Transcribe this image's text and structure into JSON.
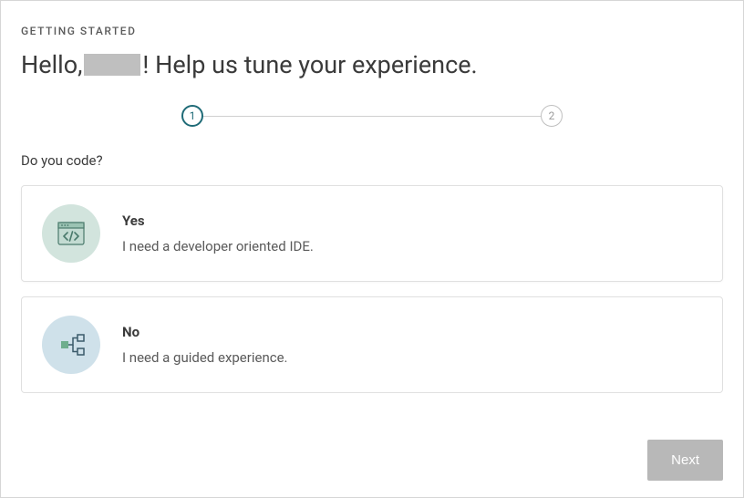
{
  "eyebrow": "GETTING STARTED",
  "greeting_prefix": "Hello,",
  "greeting_suffix": "! Help us tune your experience.",
  "stepper": {
    "step1": "1",
    "step2": "2"
  },
  "question": "Do you code?",
  "options": [
    {
      "title": "Yes",
      "subtitle": "I need a developer oriented IDE."
    },
    {
      "title": "No",
      "subtitle": "I need a guided experience."
    }
  ],
  "footer": {
    "next": "Next"
  }
}
